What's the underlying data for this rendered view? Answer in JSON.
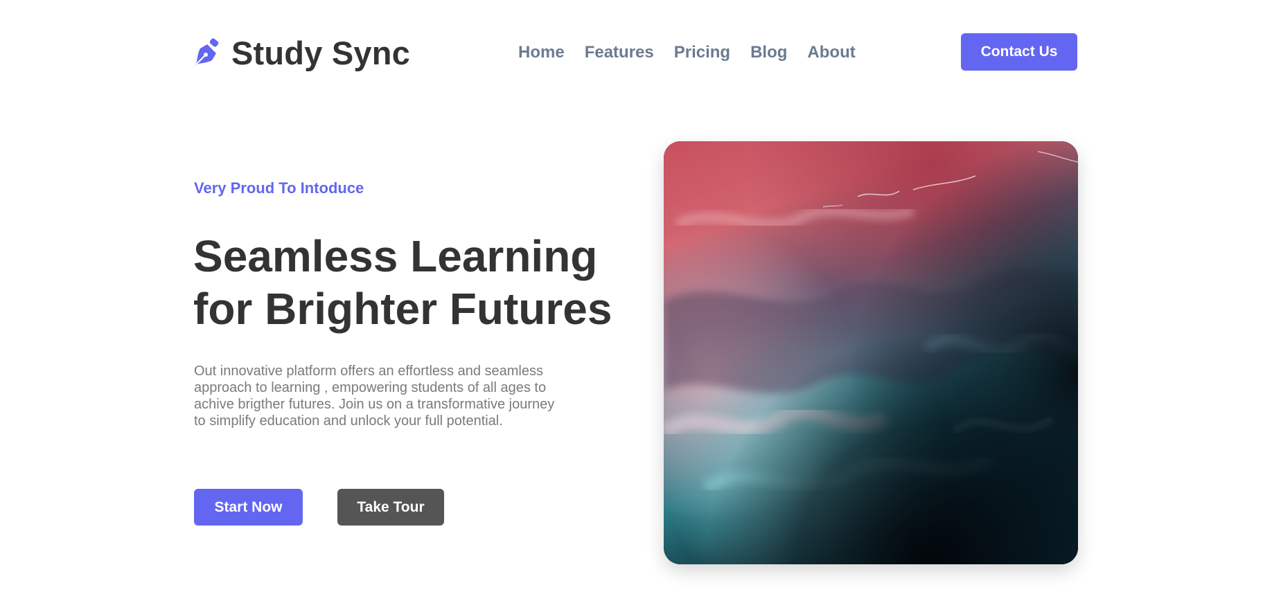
{
  "brand": {
    "name": "Study Sync",
    "icon": "fountain-pen-icon",
    "color": "#6366f1"
  },
  "nav": {
    "items": [
      {
        "label": "Home"
      },
      {
        "label": "Features"
      },
      {
        "label": "Pricing"
      },
      {
        "label": "Blog"
      },
      {
        "label": "About"
      }
    ]
  },
  "header": {
    "contact_label": "Contact Us"
  },
  "hero": {
    "kicker": "Very Proud To Intoduce",
    "title_line_1": "Seamless Learning",
    "title_line_2": "for Brighter Futures",
    "description": "Out innovative platform offers an effortless and seamless approach to learning , empowering students of all ages to achive brigther futures. Join us on a transformative journey to simplify education and unlock your full potential.",
    "start_label": "Start Now",
    "tour_label": "Take Tour",
    "image_subject": "abstract red and teal fluid ink artwork"
  },
  "colors": {
    "accent": "#6366f1",
    "heading": "#333333",
    "nav_text": "#6c7a91",
    "body_text": "#7a7a7a",
    "secondary_button": "#555555"
  }
}
